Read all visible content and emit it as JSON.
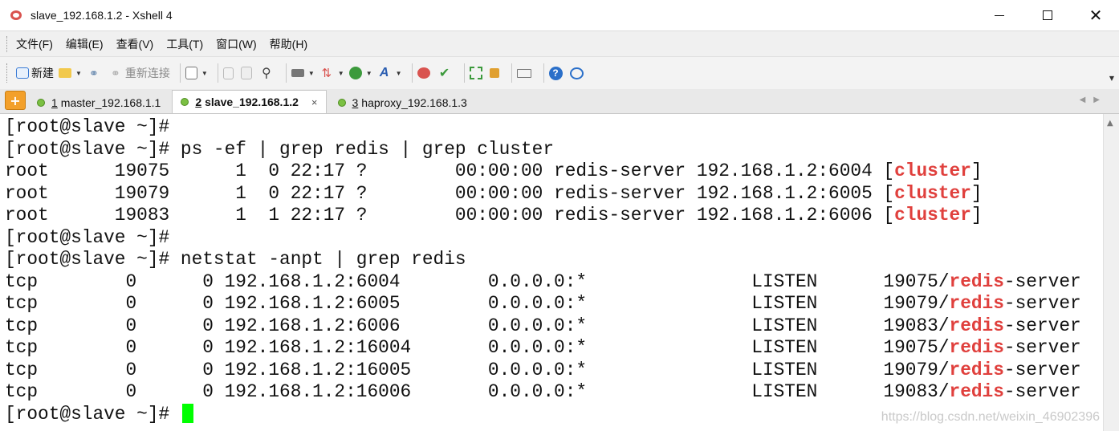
{
  "window": {
    "title": "slave_192.168.1.2 - Xshell 4",
    "min_symbol": "",
    "max_symbol": "",
    "close_symbol": "✕"
  },
  "menu": [
    "文件(F)",
    "编辑(E)",
    "查看(V)",
    "工具(T)",
    "窗口(W)",
    "帮助(H)"
  ],
  "toolbar": {
    "new_label": "新建",
    "reconnect_label": "重新连接"
  },
  "tabs": [
    {
      "num": "1",
      "label": "master_192.168.1.1",
      "active": false
    },
    {
      "num": "2",
      "label": "slave_192.168.1.2",
      "active": true
    },
    {
      "num": "3",
      "label": "haproxy_192.168.1.3",
      "active": false
    }
  ],
  "terminal": {
    "lines": [
      {
        "segments": [
          {
            "t": "[root@slave ~]#"
          }
        ]
      },
      {
        "segments": [
          {
            "t": "[root@slave ~]# ps -ef | grep redis | grep cluster"
          }
        ]
      },
      {
        "segments": [
          {
            "t": "root      19075      1  0 22:17 ?        00:00:00 redis-server 192.168.1.2:6004 ["
          },
          {
            "t": "cluster",
            "hl": true
          },
          {
            "t": "]"
          }
        ]
      },
      {
        "segments": [
          {
            "t": "root      19079      1  0 22:17 ?        00:00:00 redis-server 192.168.1.2:6005 ["
          },
          {
            "t": "cluster",
            "hl": true
          },
          {
            "t": "]"
          }
        ]
      },
      {
        "segments": [
          {
            "t": "root      19083      1  1 22:17 ?        00:00:00 redis-server 192.168.1.2:6006 ["
          },
          {
            "t": "cluster",
            "hl": true
          },
          {
            "t": "]"
          }
        ]
      },
      {
        "segments": [
          {
            "t": "[root@slave ~]#"
          }
        ]
      },
      {
        "segments": [
          {
            "t": "[root@slave ~]# netstat -anpt | grep redis"
          }
        ]
      },
      {
        "segments": [
          {
            "t": "tcp        0      0 192.168.1.2:6004        0.0.0.0:*               LISTEN      19075/"
          },
          {
            "t": "redis",
            "hl": true
          },
          {
            "t": "-server"
          }
        ]
      },
      {
        "segments": [
          {
            "t": "tcp        0      0 192.168.1.2:6005        0.0.0.0:*               LISTEN      19079/"
          },
          {
            "t": "redis",
            "hl": true
          },
          {
            "t": "-server"
          }
        ]
      },
      {
        "segments": [
          {
            "t": "tcp        0      0 192.168.1.2:6006        0.0.0.0:*               LISTEN      19083/"
          },
          {
            "t": "redis",
            "hl": true
          },
          {
            "t": "-server"
          }
        ]
      },
      {
        "segments": [
          {
            "t": "tcp        0      0 192.168.1.2:16004       0.0.0.0:*               LISTEN      19075/"
          },
          {
            "t": "redis",
            "hl": true
          },
          {
            "t": "-server"
          }
        ]
      },
      {
        "segments": [
          {
            "t": "tcp        0      0 192.168.1.2:16005       0.0.0.0:*               LISTEN      19079/"
          },
          {
            "t": "redis",
            "hl": true
          },
          {
            "t": "-server"
          }
        ]
      },
      {
        "segments": [
          {
            "t": "tcp        0      0 192.168.1.2:16006       0.0.0.0:*               LISTEN      19083/"
          },
          {
            "t": "redis",
            "hl": true
          },
          {
            "t": "-server"
          }
        ]
      },
      {
        "segments": [
          {
            "t": "[root@slave ~]# "
          }
        ],
        "cursor": true
      }
    ],
    "cursor_color": "#00ff00",
    "highlight_color": "#e0403d"
  },
  "watermark": "https://blog.csdn.net/weixin_46902396"
}
